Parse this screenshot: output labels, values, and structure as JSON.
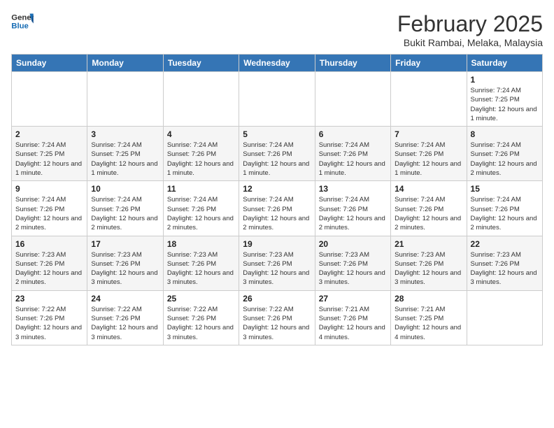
{
  "header": {
    "logo_line1": "General",
    "logo_line2": "Blue",
    "month_title": "February 2025",
    "location": "Bukit Rambai, Melaka, Malaysia"
  },
  "days_of_week": [
    "Sunday",
    "Monday",
    "Tuesday",
    "Wednesday",
    "Thursday",
    "Friday",
    "Saturday"
  ],
  "weeks": [
    [
      {
        "day": "",
        "info": ""
      },
      {
        "day": "",
        "info": ""
      },
      {
        "day": "",
        "info": ""
      },
      {
        "day": "",
        "info": ""
      },
      {
        "day": "",
        "info": ""
      },
      {
        "day": "",
        "info": ""
      },
      {
        "day": "1",
        "info": "Sunrise: 7:24 AM\nSunset: 7:25 PM\nDaylight: 12 hours and 1 minute."
      }
    ],
    [
      {
        "day": "2",
        "info": "Sunrise: 7:24 AM\nSunset: 7:25 PM\nDaylight: 12 hours and 1 minute."
      },
      {
        "day": "3",
        "info": "Sunrise: 7:24 AM\nSunset: 7:25 PM\nDaylight: 12 hours and 1 minute."
      },
      {
        "day": "4",
        "info": "Sunrise: 7:24 AM\nSunset: 7:26 PM\nDaylight: 12 hours and 1 minute."
      },
      {
        "day": "5",
        "info": "Sunrise: 7:24 AM\nSunset: 7:26 PM\nDaylight: 12 hours and 1 minute."
      },
      {
        "day": "6",
        "info": "Sunrise: 7:24 AM\nSunset: 7:26 PM\nDaylight: 12 hours and 1 minute."
      },
      {
        "day": "7",
        "info": "Sunrise: 7:24 AM\nSunset: 7:26 PM\nDaylight: 12 hours and 1 minute."
      },
      {
        "day": "8",
        "info": "Sunrise: 7:24 AM\nSunset: 7:26 PM\nDaylight: 12 hours and 2 minutes."
      }
    ],
    [
      {
        "day": "9",
        "info": "Sunrise: 7:24 AM\nSunset: 7:26 PM\nDaylight: 12 hours and 2 minutes."
      },
      {
        "day": "10",
        "info": "Sunrise: 7:24 AM\nSunset: 7:26 PM\nDaylight: 12 hours and 2 minutes."
      },
      {
        "day": "11",
        "info": "Sunrise: 7:24 AM\nSunset: 7:26 PM\nDaylight: 12 hours and 2 minutes."
      },
      {
        "day": "12",
        "info": "Sunrise: 7:24 AM\nSunset: 7:26 PM\nDaylight: 12 hours and 2 minutes."
      },
      {
        "day": "13",
        "info": "Sunrise: 7:24 AM\nSunset: 7:26 PM\nDaylight: 12 hours and 2 minutes."
      },
      {
        "day": "14",
        "info": "Sunrise: 7:24 AM\nSunset: 7:26 PM\nDaylight: 12 hours and 2 minutes."
      },
      {
        "day": "15",
        "info": "Sunrise: 7:24 AM\nSunset: 7:26 PM\nDaylight: 12 hours and 2 minutes."
      }
    ],
    [
      {
        "day": "16",
        "info": "Sunrise: 7:23 AM\nSunset: 7:26 PM\nDaylight: 12 hours and 2 minutes."
      },
      {
        "day": "17",
        "info": "Sunrise: 7:23 AM\nSunset: 7:26 PM\nDaylight: 12 hours and 3 minutes."
      },
      {
        "day": "18",
        "info": "Sunrise: 7:23 AM\nSunset: 7:26 PM\nDaylight: 12 hours and 3 minutes."
      },
      {
        "day": "19",
        "info": "Sunrise: 7:23 AM\nSunset: 7:26 PM\nDaylight: 12 hours and 3 minutes."
      },
      {
        "day": "20",
        "info": "Sunrise: 7:23 AM\nSunset: 7:26 PM\nDaylight: 12 hours and 3 minutes."
      },
      {
        "day": "21",
        "info": "Sunrise: 7:23 AM\nSunset: 7:26 PM\nDaylight: 12 hours and 3 minutes."
      },
      {
        "day": "22",
        "info": "Sunrise: 7:23 AM\nSunset: 7:26 PM\nDaylight: 12 hours and 3 minutes."
      }
    ],
    [
      {
        "day": "23",
        "info": "Sunrise: 7:22 AM\nSunset: 7:26 PM\nDaylight: 12 hours and 3 minutes."
      },
      {
        "day": "24",
        "info": "Sunrise: 7:22 AM\nSunset: 7:26 PM\nDaylight: 12 hours and 3 minutes."
      },
      {
        "day": "25",
        "info": "Sunrise: 7:22 AM\nSunset: 7:26 PM\nDaylight: 12 hours and 3 minutes."
      },
      {
        "day": "26",
        "info": "Sunrise: 7:22 AM\nSunset: 7:26 PM\nDaylight: 12 hours and 3 minutes."
      },
      {
        "day": "27",
        "info": "Sunrise: 7:21 AM\nSunset: 7:26 PM\nDaylight: 12 hours and 4 minutes."
      },
      {
        "day": "28",
        "info": "Sunrise: 7:21 AM\nSunset: 7:25 PM\nDaylight: 12 hours and 4 minutes."
      },
      {
        "day": "",
        "info": ""
      }
    ]
  ]
}
